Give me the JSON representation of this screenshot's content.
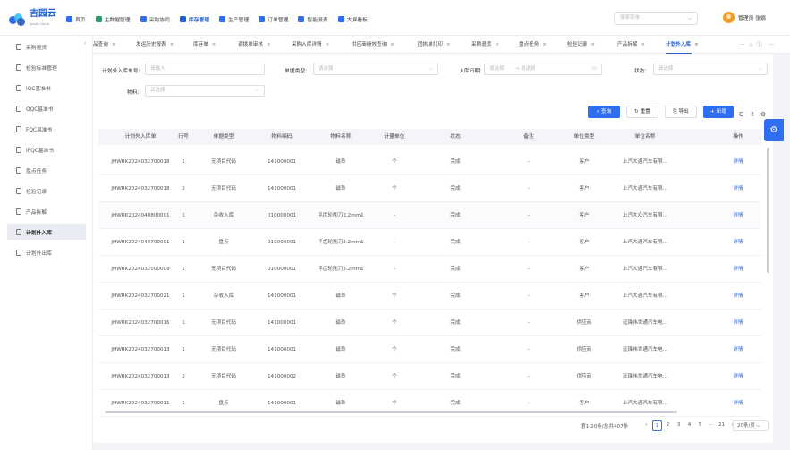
{
  "app": {
    "logo_text": "吉园云",
    "logo_sub": "Jiyuan Cloud"
  },
  "topnav": [
    {
      "label": "首页",
      "icon": "home-icon"
    },
    {
      "label": "主数据管理",
      "icon": "database-icon"
    },
    {
      "label": "采购协同",
      "icon": "cart-icon"
    },
    {
      "label": "库存管理",
      "icon": "warehouse-icon",
      "active": true
    },
    {
      "label": "生产管理",
      "icon": "factory-icon"
    },
    {
      "label": "订单管理",
      "icon": "order-icon"
    },
    {
      "label": "智能报表",
      "icon": "report-icon"
    },
    {
      "label": "大屏看板",
      "icon": "dashboard-icon"
    }
  ],
  "header": {
    "search_placeholder": "搜索菜单",
    "user_name": "管理员",
    "user_extra": "张娟"
  },
  "sidebar": [
    {
      "label": "采购退货",
      "icon": "return-icon"
    },
    {
      "label": "检验标准管理",
      "icon": "search-icon"
    },
    {
      "label": "IQC基准书",
      "icon": "doc-icon"
    },
    {
      "label": "OQC基准书",
      "icon": "doc-icon"
    },
    {
      "label": "FQC基准书",
      "icon": "doc-icon"
    },
    {
      "label": "IPQC基准书",
      "icon": "doc-icon"
    },
    {
      "label": "盘点任务",
      "icon": "doc-icon"
    },
    {
      "label": "检验记录",
      "icon": "doc-icon"
    },
    {
      "label": "产品拆解",
      "icon": "doc-icon"
    },
    {
      "label": "计划外入库",
      "icon": "doc-icon",
      "active": true
    },
    {
      "label": "计划外出库",
      "icon": "doc-icon"
    }
  ],
  "tabs": [
    "品查询",
    "发运历史报表",
    "库存单",
    "调拨单审核",
    "采购入库详情",
    "供应商绩效查询",
    "团执单打印",
    "采购退货",
    "盘点任务",
    "检验记录",
    "产品拆解",
    "计划外入库"
  ],
  "active_tab": "计划外入库",
  "filters": {
    "order_no_label": "计划外入库单号:",
    "order_no_placeholder": "请输入",
    "type_label": "单据类型:",
    "type_placeholder": "请选择",
    "date_label": "入库日期:",
    "date_start": "请选择",
    "date_sep": "→",
    "date_end": "请选择",
    "status_label": "状态:",
    "status_placeholder": "请选择",
    "material_label": "物料:",
    "material_placeholder": "请选择"
  },
  "toolbar": {
    "query": "查询",
    "reset": "重置",
    "export": "导出",
    "add": "新增"
  },
  "table": {
    "columns": [
      "计划外入库单",
      "行号",
      "单据类型",
      "物料编码",
      "物料名称",
      "计量单位",
      "状态",
      "备注",
      "单位类型",
      "单位名称",
      "操作"
    ],
    "rows": [
      [
        "JHWRK2024032700018",
        "1",
        "无项目代码",
        "141000001",
        "磁珠",
        "个",
        "完成",
        "-",
        "客户",
        "上汽大通汽车有限...",
        "详情"
      ],
      [
        "JHWRK2024032700018",
        "2",
        "无项目代码",
        "141000001",
        "磁珠",
        "个",
        "完成",
        "-",
        "客户",
        "上汽大通汽车有限...",
        "详情"
      ],
      [
        "JHWRK2024040800001",
        "1",
        "杂收入库",
        "010000001",
        "平齿轮削刀3.2mm1",
        "-",
        "完成",
        "-",
        "客户",
        "上汽大众汽车有限...",
        "详情"
      ],
      [
        "JHWRK2024040700001",
        "1",
        "盘点",
        "010000001",
        "平齿轮削刀3.2mm1",
        "-",
        "完成",
        "-",
        "客户",
        "上汽大通汽车有限...",
        "详情"
      ],
      [
        "JHWRK2024032500009",
        "1",
        "无项目代码",
        "010000001",
        "平齿轮削刀3.2mm1",
        "-",
        "完成",
        "-",
        "客户",
        "上汽大通汽车有限...",
        "详情"
      ],
      [
        "JHWRK2024032700021",
        "1",
        "杂收入库",
        "141000001",
        "磁珠",
        "个",
        "完成",
        "-",
        "客户",
        "上汽大通汽车有限...",
        "详情"
      ],
      [
        "JHWRK2024032700016",
        "1",
        "无项目代码",
        "141000001",
        "磁珠",
        "个",
        "完成",
        "-",
        "供应商",
        "延锋伟世通汽车电...",
        "详情"
      ],
      [
        "JHWRK2024032700013",
        "1",
        "无项目代码",
        "141000001",
        "磁珠",
        "个",
        "完成",
        "-",
        "供应商",
        "延锋伟世通汽车电...",
        "详情"
      ],
      [
        "JHWRK2024032700013",
        "2",
        "无项目代码",
        "141000002",
        "磁珠",
        "个",
        "完成",
        "-",
        "供应商",
        "延锋伟世通汽车电...",
        "详情"
      ],
      [
        "JHWRK2024032700011",
        "1",
        "盘点",
        "141000001",
        "磁珠",
        "个",
        "完成",
        "-",
        "客户",
        "上汽大通汽车有限...",
        "详情"
      ]
    ]
  },
  "pagination": {
    "summary": "第1-20条/总共407条",
    "pages": [
      "1",
      "2",
      "3",
      "4",
      "5",
      "···",
      "21"
    ],
    "current": "1",
    "page_size": "20条/页"
  }
}
